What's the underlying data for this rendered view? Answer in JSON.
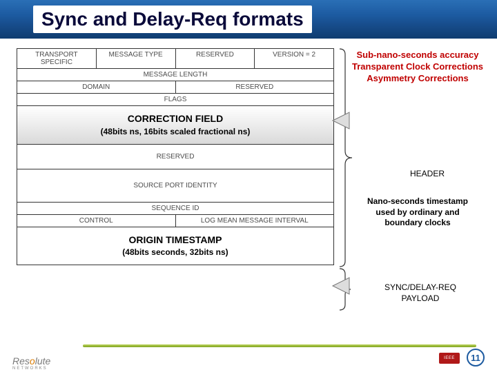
{
  "header": {
    "title": "Sync and Delay-Req formats"
  },
  "packet": {
    "row1": {
      "c1": "TRANSPORT SPECIFIC",
      "c2": "MESSAGE TYPE",
      "c3": "RESERVED",
      "c4": "VERSION = 2"
    },
    "row2": {
      "c1": "MESSAGE LENGTH"
    },
    "row3": {
      "c1": "DOMAIN",
      "c2": "RESERVED"
    },
    "row4": {
      "c1": "FLAGS"
    },
    "row5": {
      "title": "CORRECTION FIELD",
      "sub": "(48bits ns, 16bits scaled fractional ns)"
    },
    "row6": {
      "c1": "RESERVED"
    },
    "row7": {
      "c1": "SOURCE PORT IDENTITY"
    },
    "row8": {
      "c1": "SEQUENCE ID"
    },
    "row9": {
      "c1": "CONTROL",
      "c2": "LOG MEAN MESSAGE INTERVAL"
    },
    "row10": {
      "title": "ORIGIN TIMESTAMP",
      "sub": "(48bits seconds, 32bits ns)"
    }
  },
  "annotations": {
    "acc_l1": "Sub-nano-seconds accuracy",
    "acc_l2": "Transparent Clock Corrections",
    "acc_l3": "Asymmetry Corrections",
    "header_label": "HEADER",
    "ts_l1": "Nano-seconds timestamp",
    "ts_l2": "used by ordinary and",
    "ts_l3": "boundary clocks",
    "payload_l1": "SYNC/DELAY-REQ",
    "payload_l2": "PAYLOAD"
  },
  "footer": {
    "logo1": "Res",
    "logoO": "o",
    "logo2": "lute",
    "logo_sub": "NETWORKS",
    "ieee": "IEEE",
    "page": "11"
  }
}
